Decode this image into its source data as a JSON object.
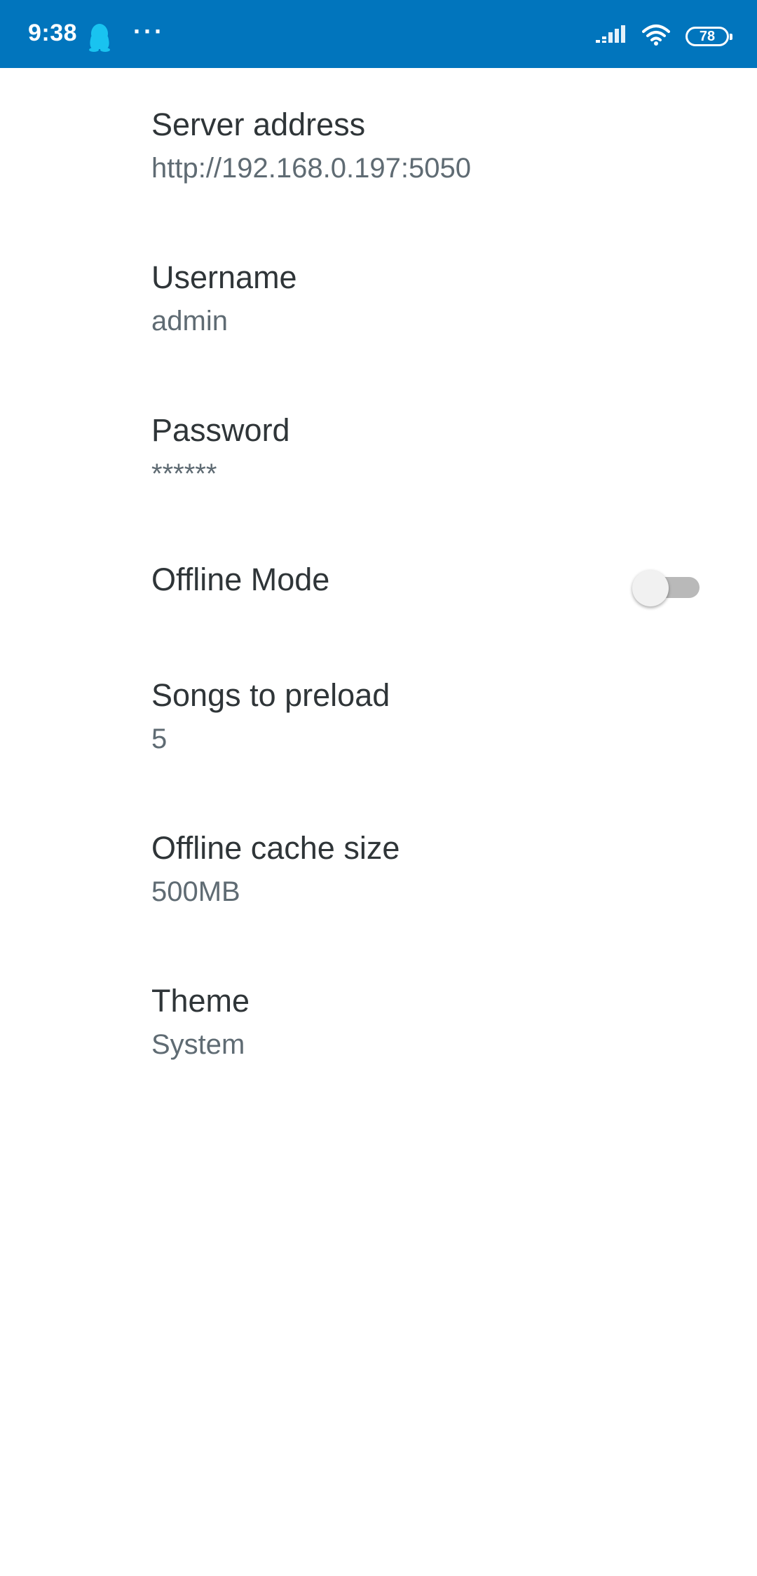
{
  "status_bar": {
    "time": "9:38",
    "more": "···",
    "battery": "78",
    "background_color": "#0175bd",
    "app_icon": "qq-penguin-icon"
  },
  "settings": {
    "server_address": {
      "title": "Server address",
      "summary": "http://192.168.0.197:5050"
    },
    "username": {
      "title": "Username",
      "summary": "admin"
    },
    "password": {
      "title": "Password",
      "summary": "******"
    },
    "offline_mode": {
      "title": "Offline Mode",
      "enabled": false
    },
    "songs_to_preload": {
      "title": "Songs to preload",
      "summary": "5"
    },
    "offline_cache_size": {
      "title": "Offline cache size",
      "summary": "500MB"
    },
    "theme": {
      "title": "Theme",
      "summary": "System"
    }
  },
  "colors": {
    "title_text": "#2f3538",
    "summary_text": "#5f6b73",
    "toggle_off_track": "#b9b9b9",
    "toggle_off_thumb": "#f1f1f1"
  }
}
